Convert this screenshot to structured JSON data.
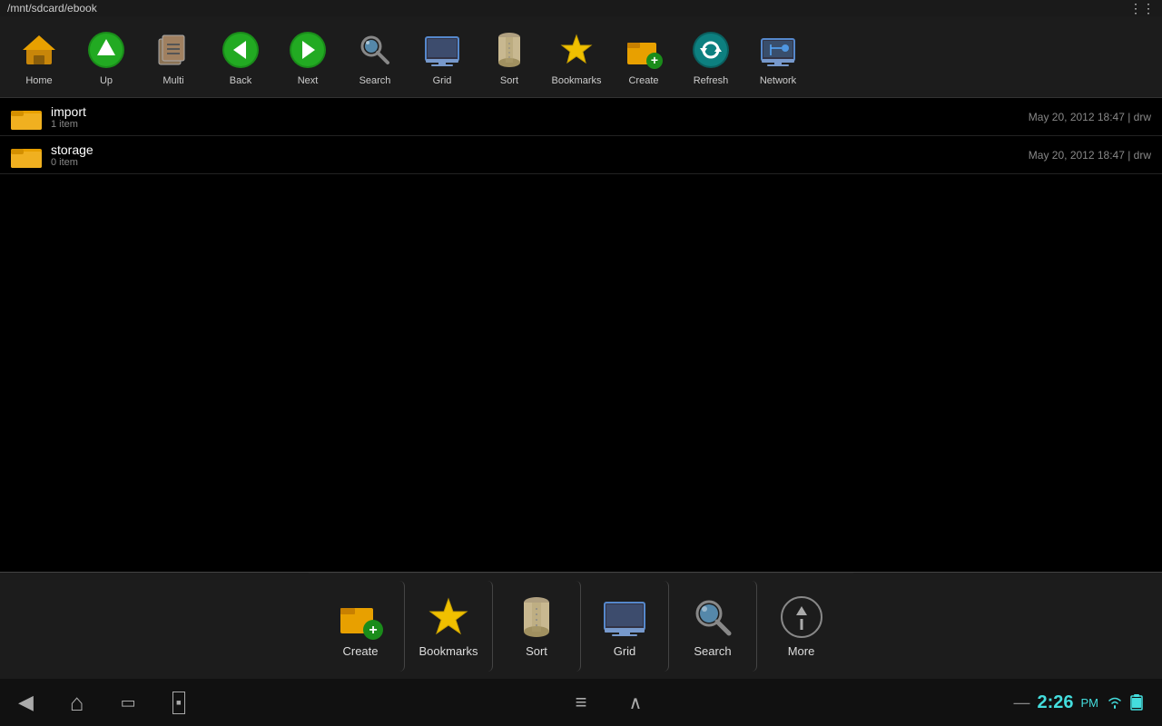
{
  "titlebar": {
    "path": "/mnt/sdcard/ebook",
    "menu_icon": "≡"
  },
  "top_toolbar": {
    "buttons": [
      {
        "id": "home",
        "label": "Home",
        "icon": "🏠",
        "icon_class": "icon-home"
      },
      {
        "id": "up",
        "label": "Up",
        "icon": "⬆",
        "icon_class": "icon-green"
      },
      {
        "id": "multi",
        "label": "Multi",
        "icon": "📋",
        "icon_class": "icon-gray"
      },
      {
        "id": "back",
        "label": "Back",
        "icon": "◀",
        "icon_class": "icon-green"
      },
      {
        "id": "next",
        "label": "Next",
        "icon": "▶",
        "icon_class": "icon-green"
      },
      {
        "id": "search",
        "label": "Search",
        "icon": "🔭",
        "icon_class": "icon-gray"
      },
      {
        "id": "grid",
        "label": "Grid",
        "icon": "🖥",
        "icon_class": "icon-blue"
      },
      {
        "id": "sort",
        "label": "Sort",
        "icon": "⌛",
        "icon_class": "icon-gray"
      },
      {
        "id": "bookmarks",
        "label": "Bookmarks",
        "icon": "⭐",
        "icon_class": "icon-star"
      },
      {
        "id": "create",
        "label": "Create",
        "icon": "📁+",
        "icon_class": "icon-star"
      },
      {
        "id": "refresh",
        "label": "Refresh",
        "icon": "🔄",
        "icon_class": "icon-teal"
      },
      {
        "id": "network",
        "label": "Network",
        "icon": "🖥",
        "icon_class": "icon-blue"
      }
    ]
  },
  "files": [
    {
      "name": "import",
      "count": "1 item",
      "meta": "May 20, 2012 18:47 | drw"
    },
    {
      "name": "storage",
      "count": "0 item",
      "meta": "May 20, 2012 18:47 | drw"
    }
  ],
  "bottom_toolbar": {
    "buttons": [
      {
        "id": "create",
        "label": "Create",
        "icon": "📁"
      },
      {
        "id": "bookmarks",
        "label": "Bookmarks",
        "icon": "⭐"
      },
      {
        "id": "sort",
        "label": "Sort",
        "icon": "⌛"
      },
      {
        "id": "grid",
        "label": "Grid",
        "icon": "🖥"
      },
      {
        "id": "search",
        "label": "Search",
        "icon": "🔭"
      },
      {
        "id": "more",
        "label": "More",
        "icon": "⊕"
      }
    ]
  },
  "navbar": {
    "time": "2:26",
    "ampm": "PM",
    "back_icon": "◀",
    "home_icon": "⌂",
    "recents_icon": "▭",
    "screenshot_icon": "⬛",
    "menu_icon": "≡",
    "chevron_icon": "∧"
  },
  "colors": {
    "accent": "#4dd",
    "folder": "#e8a000",
    "background": "#000000",
    "toolbar": "#1c1c1c"
  }
}
